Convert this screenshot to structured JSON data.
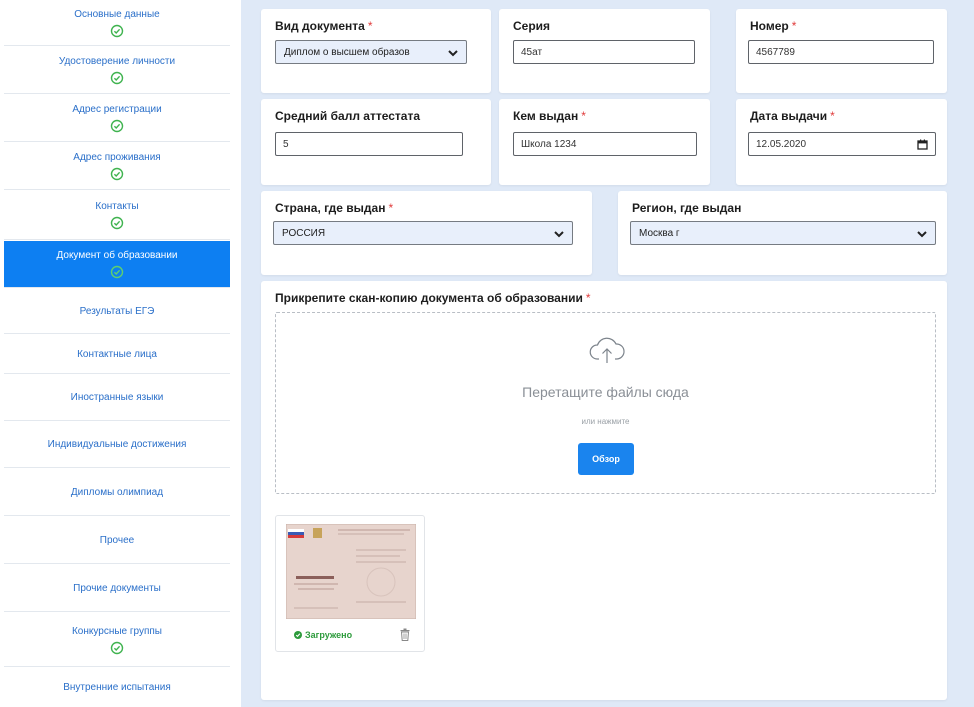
{
  "sidebar": {
    "items": [
      {
        "label": "Основные данные",
        "checked": true
      },
      {
        "label": "Удостоверение личности",
        "checked": true
      },
      {
        "label": "Адрес регистрации",
        "checked": true
      },
      {
        "label": "Адрес проживания",
        "checked": true
      },
      {
        "label": "Контакты",
        "checked": true
      },
      {
        "label": "Документ об образовании",
        "checked": true,
        "active": true
      },
      {
        "label": "Результаты ЕГЭ",
        "checked": false
      },
      {
        "label": "Контактные лица",
        "checked": false
      },
      {
        "label": "Иностранные языки",
        "checked": false
      },
      {
        "label": "Индивидуальные достижения",
        "checked": false
      },
      {
        "label": "Дипломы олимпиад",
        "checked": false
      },
      {
        "label": "Прочее",
        "checked": false
      },
      {
        "label": "Прочие документы",
        "checked": false
      },
      {
        "label": "Конкурсные группы",
        "checked": true
      },
      {
        "label": "Внутренние испытания",
        "checked": false
      }
    ]
  },
  "form": {
    "doc_type": {
      "label": "Вид документа",
      "required_mark": "*",
      "value": "Диплом о высшем образов"
    },
    "series": {
      "label": "Серия",
      "value": "45ат"
    },
    "number": {
      "label": "Номер",
      "required_mark": "*",
      "value": "4567789"
    },
    "avg_score": {
      "label": "Средний балл аттестата",
      "value": "5"
    },
    "issued_by": {
      "label": "Кем выдан",
      "required_mark": "*",
      "value": "Школа 1234"
    },
    "issue_date": {
      "label": "Дата выдачи",
      "required_mark": "*",
      "value": "12.05.2020"
    },
    "country": {
      "label": "Страна, где выдан",
      "required_mark": "*",
      "value": "РОССИЯ"
    },
    "region": {
      "label": "Регион, где выдан",
      "value": "Москва г"
    }
  },
  "upload": {
    "label": "Прикрепите скан-копию документа об образовании",
    "required_mark": "*",
    "drop_text": "Перетащите файлы сюда",
    "or_text": "или нажмите",
    "browse_label": "Обзор",
    "file_status": "Загружено"
  },
  "colors": {
    "accent": "#0d7ff2",
    "link": "#2a6fc9",
    "success": "#2d9b3c",
    "required": "#e03b3b",
    "panel_bg": "#dfe9f7"
  }
}
